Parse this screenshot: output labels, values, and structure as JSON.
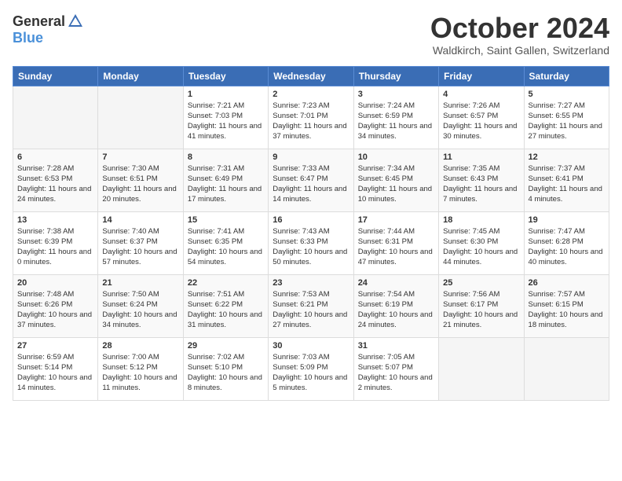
{
  "header": {
    "logo": {
      "general": "General",
      "blue": "Blue"
    },
    "title": "October 2024",
    "subtitle": "Waldkirch, Saint Gallen, Switzerland"
  },
  "days_of_week": [
    "Sunday",
    "Monday",
    "Tuesday",
    "Wednesday",
    "Thursday",
    "Friday",
    "Saturday"
  ],
  "weeks": [
    [
      {
        "day": "",
        "info": ""
      },
      {
        "day": "",
        "info": ""
      },
      {
        "day": "1",
        "info": "Sunrise: 7:21 AM\nSunset: 7:03 PM\nDaylight: 11 hours and 41 minutes."
      },
      {
        "day": "2",
        "info": "Sunrise: 7:23 AM\nSunset: 7:01 PM\nDaylight: 11 hours and 37 minutes."
      },
      {
        "day": "3",
        "info": "Sunrise: 7:24 AM\nSunset: 6:59 PM\nDaylight: 11 hours and 34 minutes."
      },
      {
        "day": "4",
        "info": "Sunrise: 7:26 AM\nSunset: 6:57 PM\nDaylight: 11 hours and 30 minutes."
      },
      {
        "day": "5",
        "info": "Sunrise: 7:27 AM\nSunset: 6:55 PM\nDaylight: 11 hours and 27 minutes."
      }
    ],
    [
      {
        "day": "6",
        "info": "Sunrise: 7:28 AM\nSunset: 6:53 PM\nDaylight: 11 hours and 24 minutes."
      },
      {
        "day": "7",
        "info": "Sunrise: 7:30 AM\nSunset: 6:51 PM\nDaylight: 11 hours and 20 minutes."
      },
      {
        "day": "8",
        "info": "Sunrise: 7:31 AM\nSunset: 6:49 PM\nDaylight: 11 hours and 17 minutes."
      },
      {
        "day": "9",
        "info": "Sunrise: 7:33 AM\nSunset: 6:47 PM\nDaylight: 11 hours and 14 minutes."
      },
      {
        "day": "10",
        "info": "Sunrise: 7:34 AM\nSunset: 6:45 PM\nDaylight: 11 hours and 10 minutes."
      },
      {
        "day": "11",
        "info": "Sunrise: 7:35 AM\nSunset: 6:43 PM\nDaylight: 11 hours and 7 minutes."
      },
      {
        "day": "12",
        "info": "Sunrise: 7:37 AM\nSunset: 6:41 PM\nDaylight: 11 hours and 4 minutes."
      }
    ],
    [
      {
        "day": "13",
        "info": "Sunrise: 7:38 AM\nSunset: 6:39 PM\nDaylight: 11 hours and 0 minutes."
      },
      {
        "day": "14",
        "info": "Sunrise: 7:40 AM\nSunset: 6:37 PM\nDaylight: 10 hours and 57 minutes."
      },
      {
        "day": "15",
        "info": "Sunrise: 7:41 AM\nSunset: 6:35 PM\nDaylight: 10 hours and 54 minutes."
      },
      {
        "day": "16",
        "info": "Sunrise: 7:43 AM\nSunset: 6:33 PM\nDaylight: 10 hours and 50 minutes."
      },
      {
        "day": "17",
        "info": "Sunrise: 7:44 AM\nSunset: 6:31 PM\nDaylight: 10 hours and 47 minutes."
      },
      {
        "day": "18",
        "info": "Sunrise: 7:45 AM\nSunset: 6:30 PM\nDaylight: 10 hours and 44 minutes."
      },
      {
        "day": "19",
        "info": "Sunrise: 7:47 AM\nSunset: 6:28 PM\nDaylight: 10 hours and 40 minutes."
      }
    ],
    [
      {
        "day": "20",
        "info": "Sunrise: 7:48 AM\nSunset: 6:26 PM\nDaylight: 10 hours and 37 minutes."
      },
      {
        "day": "21",
        "info": "Sunrise: 7:50 AM\nSunset: 6:24 PM\nDaylight: 10 hours and 34 minutes."
      },
      {
        "day": "22",
        "info": "Sunrise: 7:51 AM\nSunset: 6:22 PM\nDaylight: 10 hours and 31 minutes."
      },
      {
        "day": "23",
        "info": "Sunrise: 7:53 AM\nSunset: 6:21 PM\nDaylight: 10 hours and 27 minutes."
      },
      {
        "day": "24",
        "info": "Sunrise: 7:54 AM\nSunset: 6:19 PM\nDaylight: 10 hours and 24 minutes."
      },
      {
        "day": "25",
        "info": "Sunrise: 7:56 AM\nSunset: 6:17 PM\nDaylight: 10 hours and 21 minutes."
      },
      {
        "day": "26",
        "info": "Sunrise: 7:57 AM\nSunset: 6:15 PM\nDaylight: 10 hours and 18 minutes."
      }
    ],
    [
      {
        "day": "27",
        "info": "Sunrise: 6:59 AM\nSunset: 5:14 PM\nDaylight: 10 hours and 14 minutes."
      },
      {
        "day": "28",
        "info": "Sunrise: 7:00 AM\nSunset: 5:12 PM\nDaylight: 10 hours and 11 minutes."
      },
      {
        "day": "29",
        "info": "Sunrise: 7:02 AM\nSunset: 5:10 PM\nDaylight: 10 hours and 8 minutes."
      },
      {
        "day": "30",
        "info": "Sunrise: 7:03 AM\nSunset: 5:09 PM\nDaylight: 10 hours and 5 minutes."
      },
      {
        "day": "31",
        "info": "Sunrise: 7:05 AM\nSunset: 5:07 PM\nDaylight: 10 hours and 2 minutes."
      },
      {
        "day": "",
        "info": ""
      },
      {
        "day": "",
        "info": ""
      }
    ]
  ]
}
